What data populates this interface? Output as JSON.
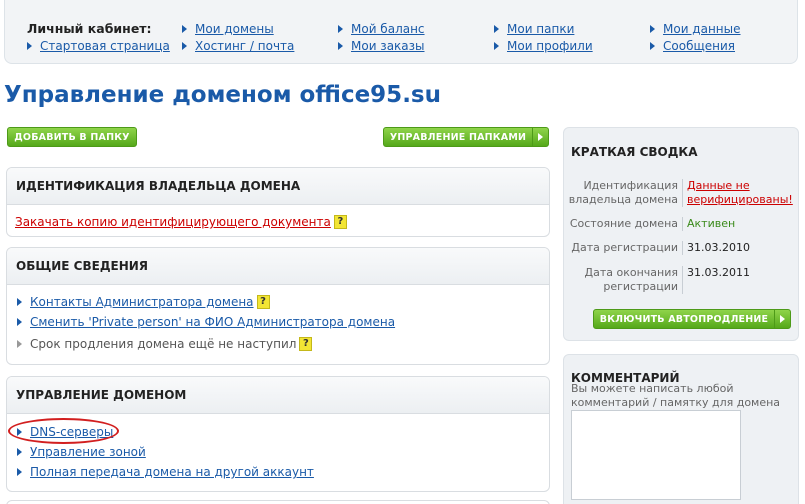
{
  "nav": {
    "cabinet_label": "Личный кабинет:",
    "start_page": "Стартовая страница",
    "columns": [
      [
        "Мои домены",
        "Хостинг / почта"
      ],
      [
        "Мой баланс",
        "Мои заказы"
      ],
      [
        "Мои папки",
        "Мои профили"
      ],
      [
        "Мои данные",
        "Сообщения"
      ]
    ]
  },
  "page_title": "Управление доменом office95.su",
  "buttons": {
    "add_to_folder": "ДОБАВИТЬ В ПАПКУ",
    "manage_folders": "УПРАВЛЕНИЕ ПАПКАМИ",
    "enable_autorenew": "ВКЛЮЧИТЬ АВТОПРОДЛЕНИЕ"
  },
  "panels": {
    "identification": {
      "title": "ИДЕНТИФИКАЦИЯ ВЛАДЕЛЬЦА ДОМЕНА",
      "upload_link": "Закачать копию идентифицирующего документа"
    },
    "general": {
      "title": "ОБЩИЕ СВЕДЕНИЯ",
      "items": [
        "Контакты Администратора домена",
        "Сменить 'Private person' на ФИО Администратора домена",
        "Срок продления домена ещё не наступил"
      ]
    },
    "management": {
      "title": "УПРАВЛЕНИЕ ДОМЕНОМ",
      "items": [
        "DNS-серверы",
        "Управление зоной",
        "Полная передача домена на другой аккаунт"
      ]
    }
  },
  "summary": {
    "title": "КРАТКАЯ СВОДКА",
    "rows": [
      {
        "label": "Идентификация владельца домена",
        "value": "Данные не верифицированы!"
      },
      {
        "label": "Состояние домена",
        "value": "Активен"
      },
      {
        "label": "Дата регистрации",
        "value": "31.03.2010"
      },
      {
        "label": "Дата окончания регистрации",
        "value": "31.03.2011"
      }
    ]
  },
  "comment": {
    "title": "КОММЕНТАРИЙ",
    "hint": "Вы можете написать любой комментарий / памятку для домена или услуги:"
  },
  "help_mark": "?",
  "colors": {
    "link": "#1a5aa8",
    "error": "#cc0000",
    "active": "#3a8a1a",
    "button": "#55a81a"
  }
}
